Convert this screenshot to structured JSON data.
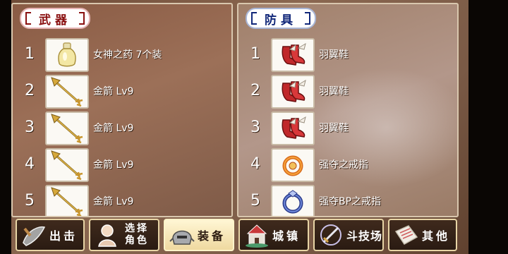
{
  "weapon_panel": {
    "tab_label": "武器",
    "slots": [
      {
        "number": "1",
        "name": "女神之药 7个装",
        "icon": "potion-bottle-icon"
      },
      {
        "number": "2",
        "name": "金箭 Lv9",
        "icon": "golden-arrow-icon"
      },
      {
        "number": "3",
        "name": "金箭 Lv9",
        "icon": "golden-arrow-icon"
      },
      {
        "number": "4",
        "name": "金箭 Lv9",
        "icon": "golden-arrow-icon"
      },
      {
        "number": "5",
        "name": "金箭 Lv9",
        "icon": "golden-arrow-icon"
      }
    ]
  },
  "armor_panel": {
    "tab_label": "防具",
    "slots": [
      {
        "number": "1",
        "name": "羽翼鞋",
        "icon": "winged-boots-icon"
      },
      {
        "number": "2",
        "name": "羽翼鞋",
        "icon": "winged-boots-icon"
      },
      {
        "number": "3",
        "name": "羽翼鞋",
        "icon": "winged-boots-icon"
      },
      {
        "number": "4",
        "name": "强夺之戒指",
        "icon": "orange-ring-icon"
      },
      {
        "number": "5",
        "name": "强夺BP之戒指",
        "icon": "blue-ring-icon"
      }
    ]
  },
  "bottom_menu": {
    "sortie": "出击",
    "select_role_line1": "选择",
    "select_role_line2": "角色",
    "equipment": "装备",
    "town": "城镇",
    "arena": "斗技场",
    "other": "其他",
    "active": "装备"
  },
  "colors": {
    "weapon_tab_text": "#8a1010",
    "armor_tab_text": "#12287a",
    "panel_border": "#d9c7ae"
  }
}
